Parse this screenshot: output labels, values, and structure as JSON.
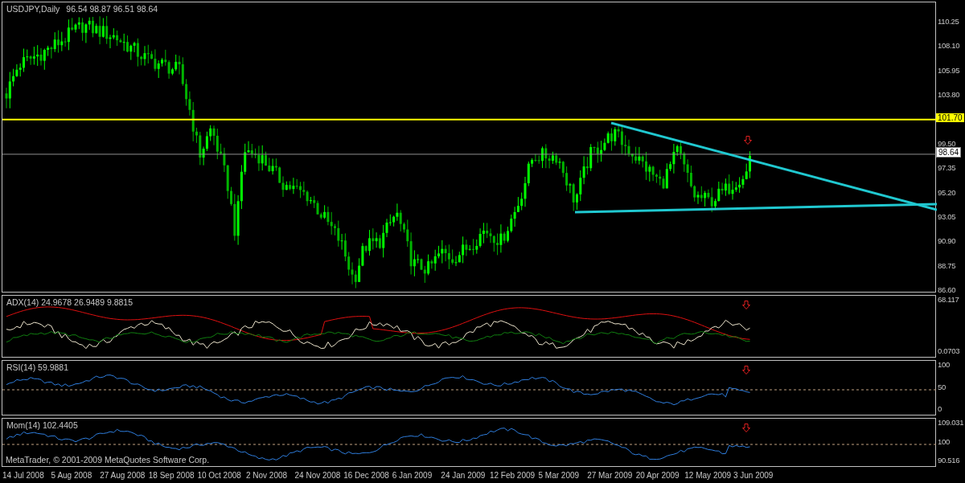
{
  "chart": {
    "symbol": "USDJPY,Daily",
    "ohlc": "96.54 98.87 96.51 98.64"
  },
  "price_axis": {
    "ticks": [
      "110.25",
      "108.10",
      "105.95",
      "103.80",
      "99.50",
      "97.35",
      "95.20",
      "93.05",
      "90.90",
      "88.75",
      "86.60"
    ],
    "horizontal_line_label": "101.70",
    "current_price_label": "98.64"
  },
  "indicators": [
    {
      "kind": "adx",
      "label": "ADX(14) 24.9678 26.9489 9.8815",
      "axis_labels": [
        "68.117",
        "0.0703"
      ]
    },
    {
      "kind": "rsi",
      "label": "RSI(14) 59.9881",
      "axis_labels": [
        "100",
        "50",
        "0"
      ]
    },
    {
      "kind": "mom",
      "label": "Mom(14) 102.4405",
      "axis_labels": [
        "109.031",
        "100",
        "90.516"
      ],
      "footer": "MetaTrader, © 2001-2009 MetaQuotes Software Corp."
    }
  ],
  "date_axis": [
    "14 Jul 2008",
    "5 Aug 2008",
    "27 Aug 2008",
    "18 Sep 2008",
    "10 Oct 2008",
    "2 Nov 2008",
    "24 Nov 2008",
    "16 Dec 2008",
    "6 Jan 2009",
    "24 Jan 2009",
    "12 Feb 2009",
    "5 Mar 2009",
    "27 Mar 2009",
    "20 Apr 2009",
    "12 May 2009",
    "3 Jun 2009"
  ]
}
